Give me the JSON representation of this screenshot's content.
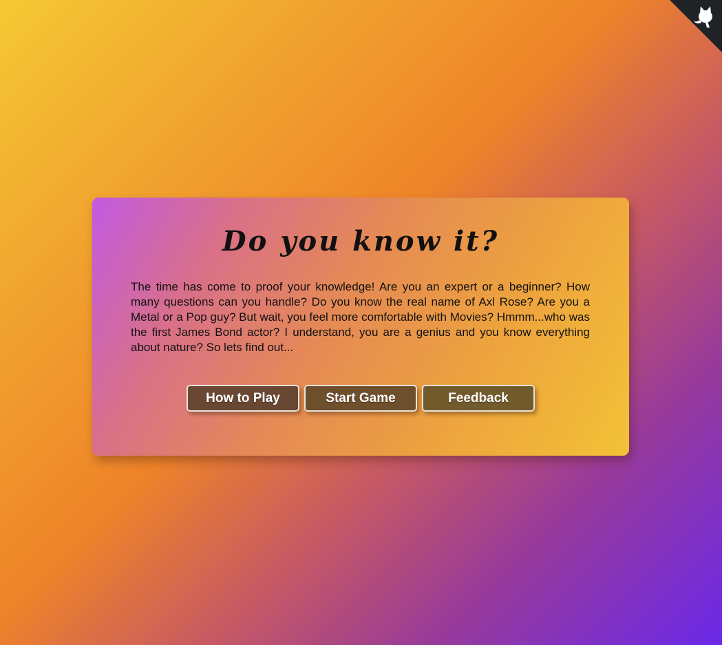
{
  "corner": {
    "icon": "github-icon",
    "bg_color": "#1f2326",
    "icon_color": "#ffffff"
  },
  "card": {
    "title": "Do you know it?",
    "intro": "The time has come to proof your knowledge! Are you an expert or a beginner? How many questions can you handle? Do you know the real name of Axl Rose? Are you a Metal or a Pop guy? But wait, you feel more comfortable with Movies? Hmmm...who was the first James Bond actor? I understand, you are a genius and you know everything about nature? So lets find out...",
    "buttons": {
      "how_to_play": "How to Play",
      "start_game": "Start Game",
      "feedback": "Feedback"
    }
  }
}
